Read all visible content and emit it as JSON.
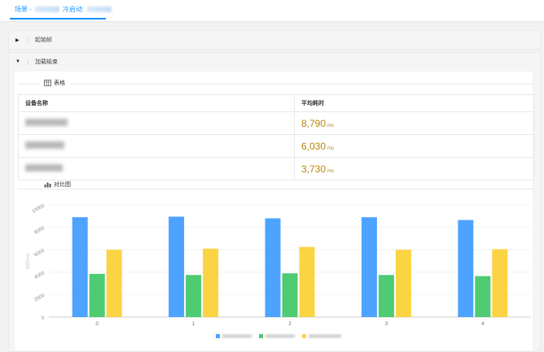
{
  "tab": {
    "prefix": "场景 -",
    "suffix": "冷启动:"
  },
  "panels": {
    "first": "起始帧",
    "second": "加载结束"
  },
  "table_section": {
    "title": "表格",
    "headers": [
      "设备名称",
      "平均耗时"
    ],
    "rows": [
      {
        "value": "8,790",
        "unit": "ms"
      },
      {
        "value": "6,030",
        "unit": "ms"
      },
      {
        "value": "3,730",
        "unit": "ms"
      }
    ]
  },
  "chart_section": {
    "title": "对比图"
  },
  "chart_data": {
    "type": "bar",
    "categories": [
      "0",
      "1",
      "2",
      "3",
      "4"
    ],
    "ylabel": "耗时(ms)",
    "ylim": [
      0,
      10000
    ],
    "yticks": [
      0,
      2000,
      4000,
      6000,
      8000,
      10000
    ],
    "series": [
      {
        "values": [
          8900,
          8950,
          8800,
          8900,
          8650
        ],
        "color": "#4da3ff"
      },
      {
        "values": [
          3850,
          3750,
          3900,
          3750,
          3650
        ],
        "color": "#4ecb73"
      },
      {
        "values": [
          6000,
          6100,
          6250,
          6000,
          6050
        ],
        "color": "#fbd444"
      }
    ]
  }
}
